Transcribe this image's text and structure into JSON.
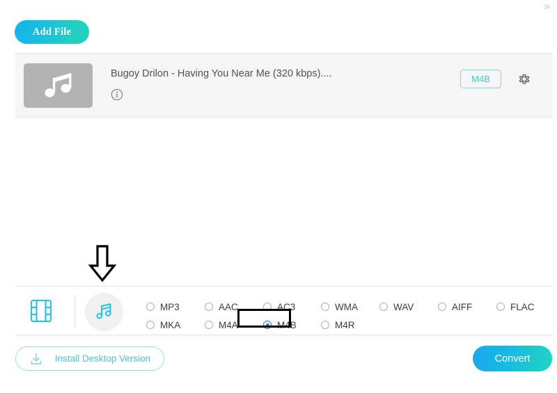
{
  "window": {
    "corner_mark": "»"
  },
  "toolbar": {
    "add_file_label": "Add File"
  },
  "file_list": {
    "items": [
      {
        "name": "Bugoy Drilon - Having You Near Me (320 kbps)....",
        "thumb_icon": "music-note-icon",
        "info_icon": "info-circle-icon",
        "output_format": "M4B",
        "settings_icon": "gear-icon"
      }
    ]
  },
  "annotation": {
    "arrow_icon": "down-arrow-outline"
  },
  "format_bar": {
    "type_tabs": [
      {
        "name": "video",
        "icon": "film-strip-icon",
        "selected": false
      },
      {
        "name": "audio",
        "icon": "music-note-icon",
        "selected": true
      }
    ],
    "formats_row1": [
      {
        "label": "MP3",
        "selected": false
      },
      {
        "label": "AAC",
        "selected": false
      },
      {
        "label": "AC3",
        "selected": false
      },
      {
        "label": "WMA",
        "selected": false
      },
      {
        "label": "WAV",
        "selected": false
      },
      {
        "label": "AIFF",
        "selected": false
      },
      {
        "label": "FLAC",
        "selected": false
      }
    ],
    "formats_row2": [
      {
        "label": "MKA",
        "selected": false
      },
      {
        "label": "M4A",
        "selected": false
      },
      {
        "label": "M4B",
        "selected": true
      },
      {
        "label": "M4R",
        "selected": false
      }
    ],
    "selected_format": "M4B"
  },
  "footer": {
    "install_label": "Install Desktop Version",
    "install_icon": "download-icon",
    "convert_label": "Convert"
  },
  "colors": {
    "accent_cyan": "#4fc3d4",
    "gradient_start": "#1ba6ef",
    "gradient_end": "#1fd4c2",
    "radio_selected": "#1a73e8",
    "highlight_box": "#000000",
    "row_background": "#f5f5f5"
  }
}
